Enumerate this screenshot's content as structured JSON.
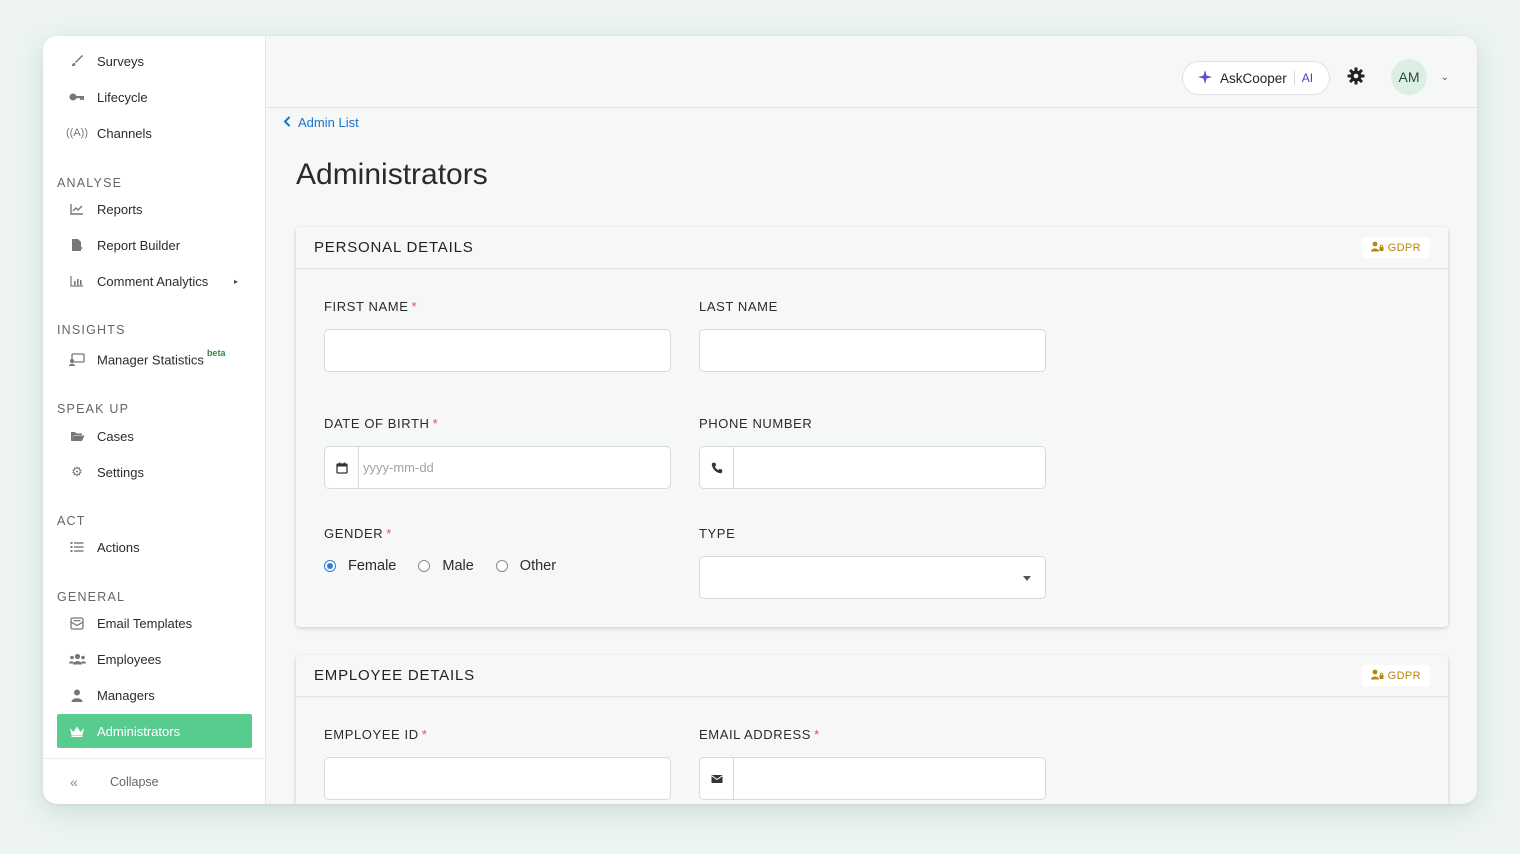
{
  "sidebar": {
    "items": [
      {
        "label": "Surveys",
        "icon": "brush-icon"
      },
      {
        "label": "Lifecycle",
        "icon": "key-icon"
      },
      {
        "label": "Channels",
        "icon": "broadcast-icon"
      },
      {
        "label": "Reports",
        "icon": "line-chart-icon"
      },
      {
        "label": "Report Builder",
        "icon": "file-chart-icon"
      },
      {
        "label": "Comment Analytics",
        "icon": "bar-chart-icon"
      },
      {
        "label": "Manager Statistics",
        "icon": "presentation-icon",
        "badge": "beta"
      },
      {
        "label": "Cases",
        "icon": "folder-open-icon"
      },
      {
        "label": "Settings",
        "icon": "gear-icon"
      },
      {
        "label": "Actions",
        "icon": "list-icon"
      },
      {
        "label": "Email Templates",
        "icon": "email-template-icon"
      },
      {
        "label": "Employees",
        "icon": "users-icon"
      },
      {
        "label": "Managers",
        "icon": "user-tie-icon"
      },
      {
        "label": "Administrators",
        "icon": "crown-icon"
      }
    ],
    "sections": {
      "analyse": "ANALYSE",
      "insights": "INSIGHTS",
      "speak_up": "SPEAK UP",
      "act": "ACT",
      "general": "GENERAL"
    },
    "collapse_label": "Collapse"
  },
  "topbar": {
    "askcooper_label": "AskCooper",
    "ai_label": "AI",
    "avatar_initials": "AM"
  },
  "breadcrumb": "Admin List",
  "page_title": "Administrators",
  "personal": {
    "title": "PERSONAL DETAILS",
    "gdpr": "GDPR",
    "first_name_label": "FIRST NAME",
    "last_name_label": "LAST NAME",
    "dob_label": "DATE OF BIRTH",
    "dob_placeholder": "yyyy-mm-dd",
    "phone_label": "PHONE NUMBER",
    "gender_label": "GENDER",
    "gender_options": [
      "Female",
      "Male",
      "Other"
    ],
    "gender_selected": "Female",
    "type_label": "TYPE"
  },
  "employee": {
    "title": "EMPLOYEE DETAILS",
    "gdpr": "GDPR",
    "employee_id_label": "EMPLOYEE ID",
    "email_label": "EMAIL ADDRESS"
  },
  "required_mark": "*",
  "colors": {
    "active_nav": "#58cc8f",
    "link": "#1a73c9",
    "required": "#d9534f",
    "gdpr": "#b8860b",
    "radio": "#2f7cd6"
  }
}
